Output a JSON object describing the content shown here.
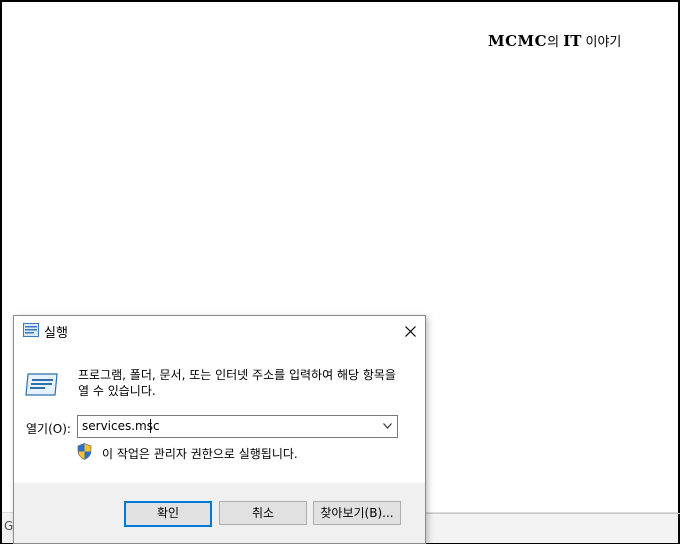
{
  "watermark": {
    "brand": "MCMC",
    "mid": "의 ",
    "it": "IT",
    "tail": " 이야기"
  },
  "background": {
    "left_char": "G"
  },
  "dialog": {
    "title": "실행",
    "description": "프로그램, 폴더, 문서, 또는 인터넷 주소를 입력하여 해당 항목을 열 수 있습니다.",
    "open_label": "열기(O):",
    "input_value": "services.msc",
    "admin_note": "이 작업은 관리자 권한으로 실행됩니다.",
    "buttons": {
      "ok": "확인",
      "cancel": "취소",
      "browse": "찾아보기(B)..."
    },
    "icons": {
      "title": "run-icon",
      "close": "close-icon",
      "shield": "uac-shield-icon",
      "dropdown": "chevron-down-icon"
    }
  }
}
